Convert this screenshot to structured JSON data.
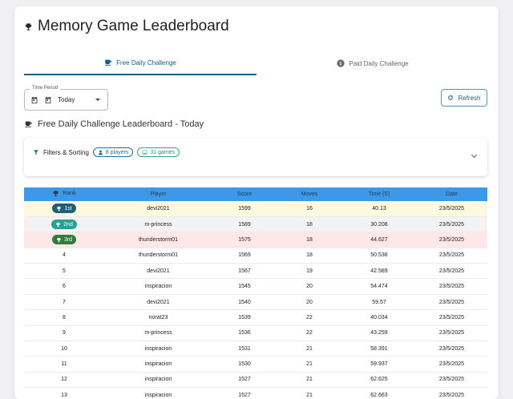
{
  "page": {
    "title": "Memory Game Leaderboard"
  },
  "tabs": [
    {
      "label": "Free Daily Challenge",
      "icon": "coffee-icon",
      "active": true
    },
    {
      "label": "Paid Daily Challenge",
      "icon": "dollar-icon",
      "active": false
    }
  ],
  "period": {
    "label": "Time Period",
    "value": "Today"
  },
  "refresh": {
    "label": "Refresh"
  },
  "subtitle": "Free Daily Challenge Leaderboard - Today",
  "filters": {
    "label": "Filters & Sorting",
    "players_chip": "8 players",
    "games_chip": "31 games"
  },
  "table": {
    "headers": [
      "Rank",
      "Player",
      "Score",
      "Moves",
      "Time (S)",
      "Date"
    ],
    "rows": [
      {
        "rank": "1st",
        "player": "devi2021",
        "score": "1599",
        "moves": "16",
        "time": "40.13",
        "date": "23/5/2025"
      },
      {
        "rank": "2nd",
        "player": "m-princess",
        "score": "1589",
        "moves": "18",
        "time": "30.208",
        "date": "23/5/2025"
      },
      {
        "rank": "3rd",
        "player": "thunderstorm01",
        "score": "1575",
        "moves": "18",
        "time": "44.627",
        "date": "23/5/2025"
      },
      {
        "rank": "4",
        "player": "thunderstorm01",
        "score": "1569",
        "moves": "18",
        "time": "50.538",
        "date": "23/5/2025"
      },
      {
        "rank": "5",
        "player": "devi2021",
        "score": "1567",
        "moves": "19",
        "time": "42.589",
        "date": "23/5/2025"
      },
      {
        "rank": "6",
        "player": "inspiracion",
        "score": "1545",
        "moves": "20",
        "time": "54.474",
        "date": "23/5/2025"
      },
      {
        "rank": "7",
        "player": "devi2021",
        "score": "1540",
        "moves": "20",
        "time": "59.57",
        "date": "23/5/2025"
      },
      {
        "rank": "8",
        "player": "norat23",
        "score": "1539",
        "moves": "22",
        "time": "40.034",
        "date": "23/5/2025"
      },
      {
        "rank": "9",
        "player": "m-princess",
        "score": "1536",
        "moves": "22",
        "time": "43.259",
        "date": "23/5/2025"
      },
      {
        "rank": "10",
        "player": "inspiracion",
        "score": "1531",
        "moves": "21",
        "time": "58.391",
        "date": "23/5/2025"
      },
      {
        "rank": "11",
        "player": "inspiracion",
        "score": "1530",
        "moves": "21",
        "time": "59.937",
        "date": "23/5/2025"
      },
      {
        "rank": "12",
        "player": "inspiracion",
        "score": "1527",
        "moves": "21",
        "time": "62.625",
        "date": "23/5/2025"
      },
      {
        "rank": "13",
        "player": "inspiracion",
        "score": "1527",
        "moves": "21",
        "time": "62.663",
        "date": "23/5/2025"
      }
    ]
  },
  "colors": {
    "accent": "#1f5f7e",
    "header_bg": "#3d98e8",
    "gold": "#fdf8e0",
    "silver": "#f3f3f3",
    "bronze": "#fde7e7"
  }
}
